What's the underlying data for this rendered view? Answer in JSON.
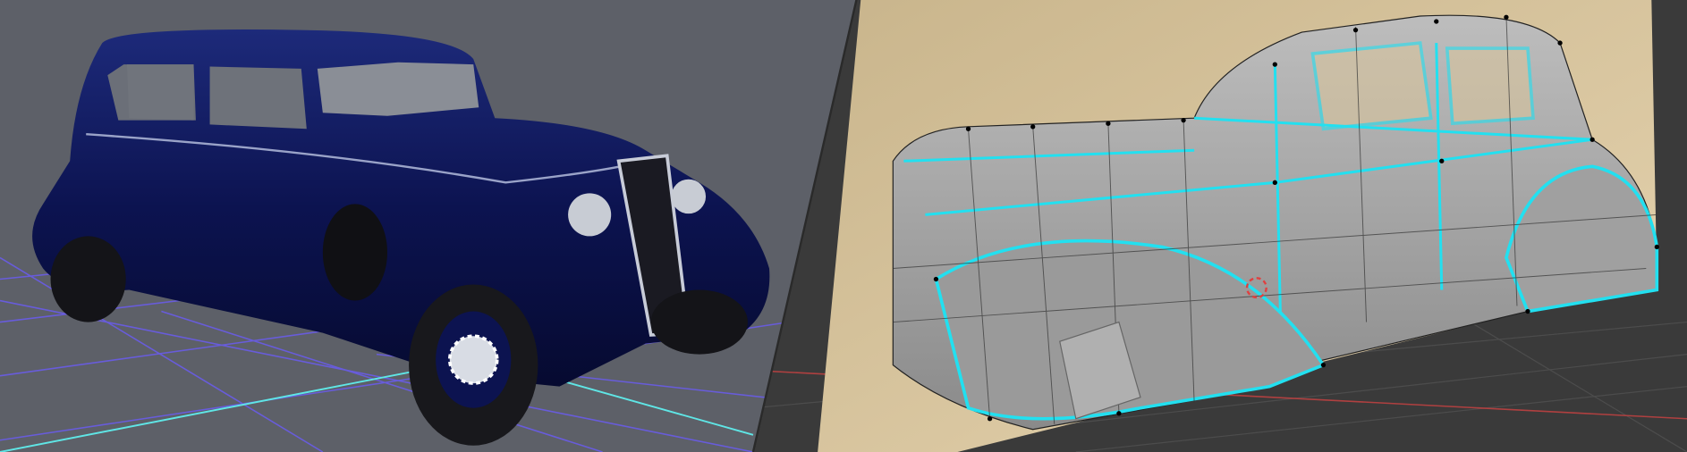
{
  "colors": {
    "left_background": "#5d6068",
    "grid_line": "#6a5cf0",
    "grid_axis": "#5fe6e6",
    "car_paint": "#0e1550",
    "right_background": "#3a3a3a",
    "reference_plane": "#d8c49c",
    "mesh_body": "#a9a9a9",
    "mesh_seam": "#22e0f0",
    "mesh_vertex": "#000000"
  },
  "panels": {
    "left": "rendered-viewport",
    "right": "wireframe-edit-viewport"
  }
}
